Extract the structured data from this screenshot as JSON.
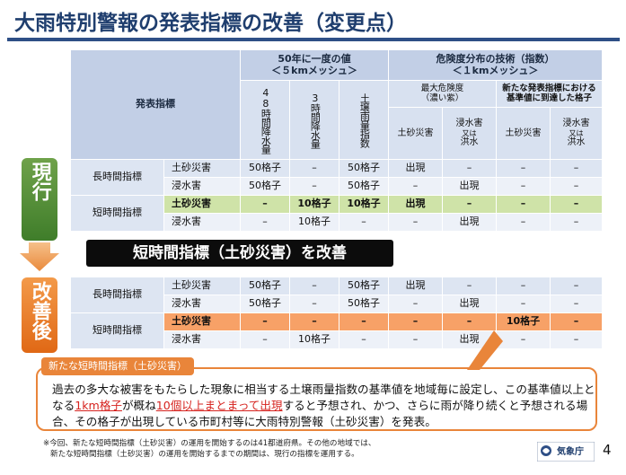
{
  "title": "大雨特別警報の発表指標の改善（変更点）",
  "header": {
    "indicator": "発表指標",
    "group1_line1": "50年に一度の値",
    "group1_line2": "＜５kmメッシュ＞",
    "group2_line1": "危険度分布の技術（指数）",
    "group2_line2": "＜１kmメッシュ＞",
    "col_48h": "48時間降水量",
    "col_3h": "3時間降水量",
    "col_soil": "土壌雨量指数",
    "sub_max_line1": "最大危険度",
    "sub_max_line2": "（濃い紫）",
    "sub_new_line1": "新たな発表指標における",
    "sub_new_line2": "基準値に到達した格子",
    "col_landslide_a": "土砂災害",
    "col_flood_a_line1": "浸水害",
    "col_flood_a_line2": "又は",
    "col_flood_a_line3": "洪水",
    "col_landslide_b": "土砂災害",
    "col_flood_b_line1": "浸水害",
    "col_flood_b_line2": "又は",
    "col_flood_b_line3": "洪水"
  },
  "badges": {
    "current": "現行",
    "improved": "改善後"
  },
  "current_rows": [
    {
      "group": "長時間指標",
      "type": "土砂災害",
      "c1": "50格子",
      "c2": "–",
      "c3": "50格子",
      "c4": "出現",
      "c5": "–",
      "c6": "–",
      "c7": "–"
    },
    {
      "type": "浸水害",
      "c1": "50格子",
      "c2": "–",
      "c3": "50格子",
      "c4": "–",
      "c5": "出現",
      "c6": "–",
      "c7": "–"
    },
    {
      "group": "短時間指標",
      "type": "土砂災害",
      "c1": "–",
      "c2": "10格子",
      "c3": "10格子",
      "c4": "出現",
      "c5": "–",
      "c6": "–",
      "c7": "–"
    },
    {
      "type": "浸水害",
      "c1": "–",
      "c2": "10格子",
      "c3": "–",
      "c4": "–",
      "c5": "出現",
      "c6": "–",
      "c7": "–"
    }
  ],
  "banner": "短時間指標（土砂災害）を改善",
  "improved_rows": [
    {
      "group": "長時間指標",
      "type": "土砂災害",
      "c1": "50格子",
      "c2": "–",
      "c3": "50格子",
      "c4": "出現",
      "c5": "–",
      "c6": "–",
      "c7": "–"
    },
    {
      "type": "浸水害",
      "c1": "50格子",
      "c2": "–",
      "c3": "50格子",
      "c4": "–",
      "c5": "出現",
      "c6": "–",
      "c7": "–"
    },
    {
      "group": "短時間指標",
      "type": "土砂災害",
      "c1": "–",
      "c2": "–",
      "c3": "–",
      "c4": "–",
      "c5": "–",
      "c6": "10格子",
      "c7": "–"
    },
    {
      "type": "浸水害",
      "c1": "–",
      "c2": "10格子",
      "c3": "–",
      "c4": "–",
      "c5": "出現",
      "c6": "–",
      "c7": "–"
    }
  ],
  "callout": {
    "tag": "新たな短時間指標（土砂災害）",
    "text_1": "過去の多大な被害をもたらした現象に相当する土壌雨量指数の基準値を地域毎に設定し、この基準値以上となる",
    "highlight_1": "1km格子",
    "text_2": "が概ね",
    "highlight_2": "10個以上まとまって出現",
    "text_3": "すると予想され、かつ、さらに雨が降り続くと予想される場合、その格子が出現している市町村等に大雨特別警報（土砂災害）を発表。"
  },
  "note_line1": "※今回、新たな短時間指標（土砂災害）の運用を開始するのは41都道府県。その他の地域では、",
  "note_line2": "新たな短時間指標（土砂災害）の運用を開始するまでの期間は、現行の指標を運用する。",
  "logo_text": "気象庁",
  "page_number": "4",
  "colors": {
    "header_blue": "#c2cfe6",
    "current_green": "#3f7d2a",
    "improved_orange": "#e06815",
    "highlight_green": "#cfe3a8",
    "highlight_orange": "#f7a167",
    "title_navy": "#1f3e6e"
  }
}
